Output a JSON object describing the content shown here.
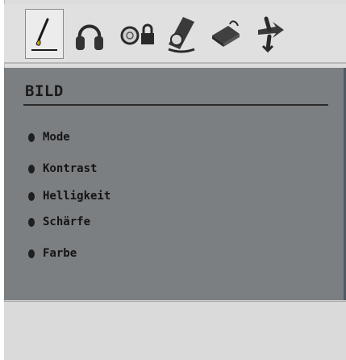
{
  "toolbar": {
    "icons": [
      {
        "name": "picture-icon",
        "selected": true
      },
      {
        "name": "sound-icon",
        "selected": false
      },
      {
        "name": "lock-icon",
        "selected": false
      },
      {
        "name": "settings-icon",
        "selected": false
      },
      {
        "name": "source-icon",
        "selected": false
      },
      {
        "name": "install-icon",
        "selected": false
      }
    ]
  },
  "menu": {
    "title": "BILD",
    "items": [
      "Mode",
      "Kontrast",
      "Helligkeit",
      "Schärfe",
      "Farbe"
    ]
  },
  "colors": {
    "panel": "#7c7f82",
    "text": "#141414",
    "toolbar": "#e0e0e0"
  }
}
